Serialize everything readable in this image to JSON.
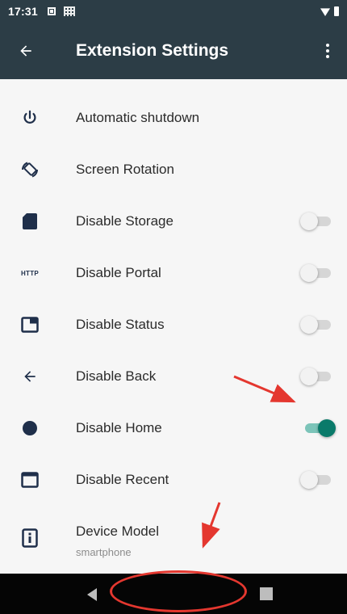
{
  "status_bar": {
    "time": "17:31"
  },
  "app_bar": {
    "title": "Extension Settings"
  },
  "settings": [
    {
      "id": "automatic-shutdown",
      "icon": "power-icon",
      "label": "Automatic shutdown",
      "has_switch": false
    },
    {
      "id": "screen-rotation",
      "icon": "screen-rotation-icon",
      "label": "Screen Rotation",
      "has_switch": false
    },
    {
      "id": "disable-storage",
      "icon": "sd-card-icon",
      "label": "Disable Storage",
      "has_switch": true,
      "on": false
    },
    {
      "id": "disable-portal",
      "icon": "http-icon",
      "icon_text": "HTTP",
      "label": "Disable Portal",
      "has_switch": true,
      "on": false
    },
    {
      "id": "disable-status",
      "icon": "window-icon",
      "label": "Disable Status",
      "has_switch": true,
      "on": false
    },
    {
      "id": "disable-back",
      "icon": "arrow-left-icon",
      "label": "Disable Back",
      "has_switch": true,
      "on": false
    },
    {
      "id": "disable-home",
      "icon": "circle-icon",
      "label": "Disable Home",
      "has_switch": true,
      "on": true
    },
    {
      "id": "disable-recent",
      "icon": "window-outline-icon",
      "label": "Disable Recent",
      "has_switch": true,
      "on": false
    },
    {
      "id": "device-model",
      "icon": "info-icon",
      "label": "Device Model",
      "sub": "smartphone",
      "has_switch": false
    }
  ],
  "colors": {
    "app_bar": "#2c3d46",
    "accent": "#0a7a6a",
    "accent_track": "#7cc4b9",
    "icon": "#1f2f4a",
    "annotation": "#e4372f",
    "nav_bar": "#050505"
  }
}
